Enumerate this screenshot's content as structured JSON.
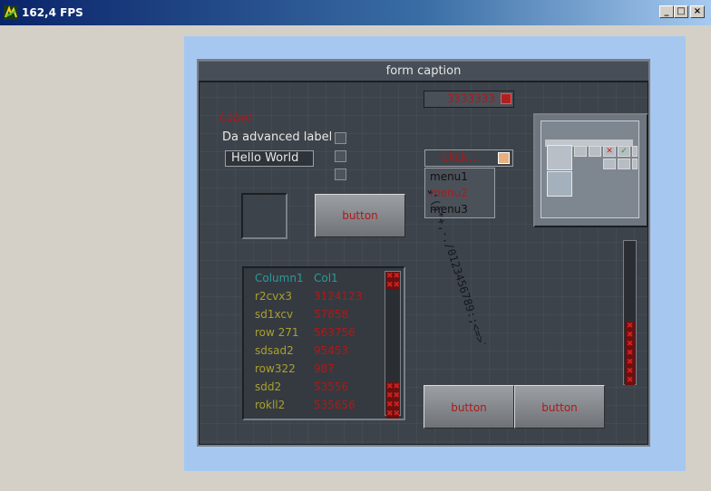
{
  "window": {
    "title": "162,4 FPS",
    "min_glyph": "_",
    "max_glyph": "□",
    "close_glyph": "×"
  },
  "form": {
    "caption": "form caption",
    "label": "Label",
    "advanced_label": "Da advanced label",
    "editbox_value": "Hello World",
    "spinbox_value": "3333333",
    "combo_value": "click...",
    "menu_items": [
      "menu1",
      "menu2",
      "menu3"
    ],
    "button_label": "button",
    "button_bottom_left": "button",
    "button_bottom_right": "button",
    "rotated_text_1": "abcdefghijklmnopqrstuvwxyz{|}",
    "rotated_text_2": "!\"#$%&'()*+,-./0123456789:;<=>?@ABCDEFGHIJKLMNOPQRSTUVWXYZ",
    "table": {
      "headers": [
        "Column1",
        "Col1"
      ],
      "rows": [
        [
          "r2cvx3",
          "3124123"
        ],
        [
          "sd1xcv",
          "57858"
        ],
        [
          "row 271",
          "563756"
        ],
        [
          "sdsad2",
          "95453"
        ],
        [
          "row322",
          "987"
        ],
        [
          "sdd2",
          "53556"
        ],
        [
          "rokll2",
          "535656"
        ]
      ]
    }
  },
  "colors": {
    "form_bg": "#3d434a",
    "accent_red": "#b01818",
    "header_teal": "#2a9a9a",
    "cell_olive": "#a8a030",
    "viewport_blue": "#a6c8f0"
  }
}
